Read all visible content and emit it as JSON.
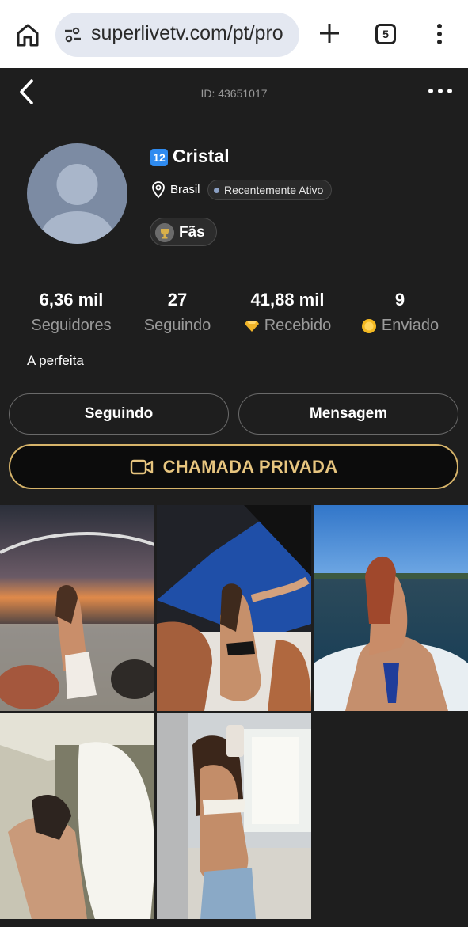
{
  "browser": {
    "url": "superlivetv.com/pt/pro",
    "tab_count": "5"
  },
  "header": {
    "user_id": "ID: 43651017"
  },
  "profile": {
    "level": "12",
    "name": "Cristal",
    "country": "Brasil",
    "status": "Recentemente Ativo",
    "fans_label": "Fãs",
    "bio": "A perfeita"
  },
  "stats": [
    {
      "value": "6,36 mil",
      "label": "Seguidores",
      "icon": ""
    },
    {
      "value": "27",
      "label": "Seguindo",
      "icon": ""
    },
    {
      "value": "41,88 mil",
      "label": "Recebido",
      "icon": "diamond-icon"
    },
    {
      "value": "9",
      "label": "Enviado",
      "icon": "coin-icon"
    }
  ],
  "actions": {
    "following_label": "Seguindo",
    "message_label": "Mensagem",
    "private_call_label": "CHAMADA PRIVADA"
  },
  "colors": {
    "accent_gold": "#e7c57f",
    "level_blue": "#2f8bf0",
    "background": "#1e1e1e"
  },
  "photos": [
    {
      "name": "photo-boat-sunset"
    },
    {
      "name": "photo-boat-selfie"
    },
    {
      "name": "photo-lake-jetski"
    },
    {
      "name": "photo-hallway-selfie"
    },
    {
      "name": "photo-mirror-selfie"
    }
  ]
}
